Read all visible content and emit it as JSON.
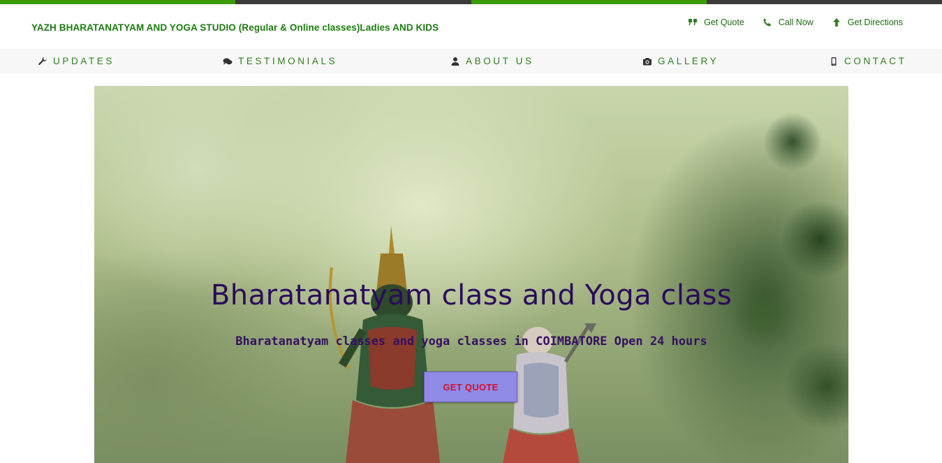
{
  "colors": {
    "accent_green": "#3c9c07",
    "stripe_dark": "#3a3a3a",
    "brand_text": "#1e7a12",
    "nav_text": "#2e7d1d",
    "nav_bg": "#f7f7f7",
    "hero_title": "#2b0a5c",
    "hero_sub": "#351060",
    "button_bg": "#8f8ae6",
    "button_text": "#d0112b"
  },
  "header": {
    "brand": "YAZH BHARATANATYAM AND YOGA STUDIO (Regular & Online classes)Ladies AND KIDS",
    "actions": [
      {
        "label": "Get Quote",
        "icon": "quote-icon"
      },
      {
        "label": "Call Now",
        "icon": "phone-icon"
      },
      {
        "label": "Get Directions",
        "icon": "arrow-up-icon"
      }
    ]
  },
  "nav": {
    "items": [
      {
        "label": "UPDATES",
        "icon": "wrench-icon"
      },
      {
        "label": "TESTIMONIALS",
        "icon": "comments-icon"
      },
      {
        "label": "ABOUT US",
        "icon": "user-icon"
      },
      {
        "label": "GALLERY",
        "icon": "camera-icon"
      },
      {
        "label": "CONTACT",
        "icon": "mobile-icon"
      }
    ]
  },
  "hero": {
    "title": "Bharatanatyam class and Yoga class",
    "subtitle": "Bharatanatyam classes and yoga classes in COIMBATORE Open 24 hours",
    "button": "GET QUOTE"
  }
}
